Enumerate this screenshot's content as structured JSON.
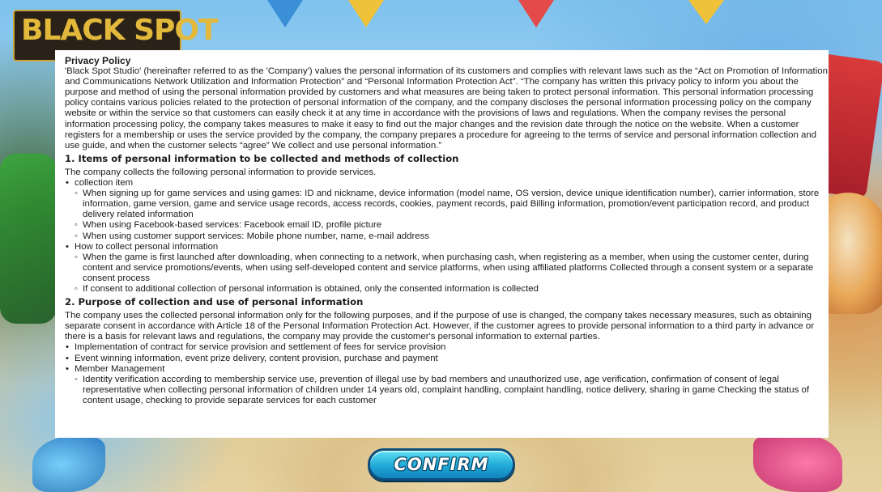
{
  "logo": {
    "text": "BLACK SPOT"
  },
  "privacy": {
    "title": "Privacy Policy",
    "intro": "'Black Spot Studio' (hereinafter referred to as the 'Company') values the personal information of its customers and complies with relevant laws such as the “Act on Promotion of Information and Communications Network Utilization and Information Protection” and “Personal Information Protection Act”. “The company has written this privacy policy to inform you about the purpose and method of using the personal information provided by customers and what measures are being taken to protect personal information. This personal information processing policy contains various policies related to the protection of personal information of the company, and the company discloses the personal information processing policy on the company website or within the service so that customers can easily check it at any time in accordance with the provisions of laws and regulations. When the company revises the personal information processing policy, the company takes measures to make it easy to find out the major changes and the revision date through the notice on the website. When a customer registers for a membership or uses the service provided by the company, the company prepares a procedure for agreeing to the terms of service and personal information collection and use guide, and when the customer selects “agree” We collect and use personal information.”",
    "section1": {
      "heading": "1. Items of personal information to be collected and methods of collection",
      "text": "The company collects the following personal information to provide services.",
      "collection_label": "collection item",
      "collection_items": [
        "When signing up for game services and using games: ID and nickname, device information (model name, OS version, device unique identification number), carrier information, store information, game version, game and service usage records, access records, cookies, payment records, paid Billing information, promotion/event participation record, and product delivery related information",
        "When using Facebook-based services: Facebook email ID, profile picture",
        "When using customer support services: Mobile phone number, name, e-mail address"
      ],
      "how_label": "How to collect personal information",
      "how_items": [
        "When the game is first launched after downloading, when connecting to a network, when purchasing cash, when registering as a member, when using the customer center, during content and service promotions/events, when using self-developed content and service platforms, when using affiliated platforms Collected through a consent system or a separate consent process",
        "If consent to additional collection of personal information is obtained, only the consented information is collected"
      ]
    },
    "section2": {
      "heading": "2. Purpose of collection and use of personal information",
      "text": "The company uses the collected personal information only for the following purposes, and if the purpose of use is changed, the company takes necessary measures, such as obtaining separate consent in accordance with Article 18 of the Personal Information Protection Act. However, if the customer agrees to provide personal information to a third party in advance or there is a basis for relevant laws and regulations, the company may provide the customer's personal information to external parties.",
      "items": [
        "Implementation of contract for service provision and settlement of fees for service provision",
        "Event winning information, event prize delivery, content provision, purchase and payment"
      ],
      "member_label": "Member Management",
      "member_items": [
        "Identity verification according to membership service use, prevention of illegal use by bad members and unauthorized use, age verification, confirmation of consent of legal representative when collecting personal information of children under 14 years old, complaint handling, complaint handling, notice delivery, sharing in game Checking the status of content usage, checking to provide separate services for each customer"
      ]
    }
  },
  "confirm_button": {
    "label": "CONFIRM"
  },
  "colors": {
    "button_top": "#5be0f4",
    "button_bottom": "#1083bd",
    "button_border": "#0e4d7a",
    "logo_gold": "#e2b93b"
  }
}
